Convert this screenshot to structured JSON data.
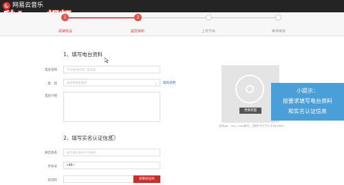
{
  "app": {
    "name": "网易云音乐"
  },
  "watermark": {
    "text": "秒dong视频"
  },
  "steps": [
    {
      "label": "阅读协议",
      "num": "1"
    },
    {
      "label": "提交资料",
      "num": "2"
    },
    {
      "label": "上传节目",
      "num": ""
    },
    {
      "label": "等待审核",
      "num": ""
    }
  ],
  "section1": {
    "title": "1、填写电台资料",
    "name_label": "电台名称",
    "name_placeholder": "不可使用任何广告内容",
    "category_label": "类　别",
    "category_placeholder": "请选择电台类别",
    "category_link": "类别说明",
    "intro_label": "电台介绍"
  },
  "section2": {
    "title": "2、填写实名认证信息",
    "info_icon": "i",
    "realname_label": "真实姓名",
    "realname_placeholder": "填写真实姓名不可修改",
    "phone_label": "手机号",
    "phone_prefix": "+86",
    "phone_arrow": "▾",
    "code_label": "验证码",
    "code_button": "获取验证码"
  },
  "cover": {
    "button": "更换封面",
    "note": "支持jpg、png、bmp格式，且图片尺寸不小于640*640"
  },
  "tip": {
    "title": "小提示：",
    "line1": "按要求填写电台资料",
    "line2": "和实名认证信息"
  },
  "colors": {
    "accent": "#e0554d",
    "topbar": "#242424",
    "tip": "#4a9fd8",
    "link": "#2b6fc4"
  }
}
